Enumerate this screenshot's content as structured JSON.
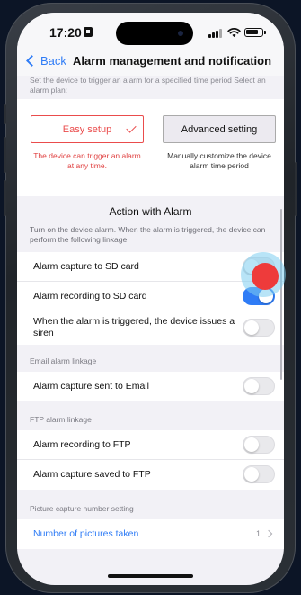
{
  "status": {
    "time": "17:20"
  },
  "nav": {
    "back_label": "Back",
    "title": "Alarm management and notification"
  },
  "intro": {
    "hint": "Set the device to trigger an alarm for a specified time period Select an alarm plan:"
  },
  "plans": {
    "easy": {
      "label": "Easy setup",
      "desc": "The device can trigger an alarm at any time.",
      "selected": true
    },
    "advanced": {
      "label": "Advanced setting",
      "desc": "Manually customize the device alarm time period"
    }
  },
  "action": {
    "title": "Action with Alarm",
    "desc": "Turn on the device alarm. When the alarm is triggered, the device can perform the following linkage:",
    "rows": [
      {
        "label": "Alarm capture to SD card",
        "on": false
      },
      {
        "label": "Alarm recording to SD card",
        "on": true
      },
      {
        "label": "When the alarm is triggered, the device issues a siren",
        "on": false
      }
    ]
  },
  "email": {
    "header": "Email alarm linkage",
    "rows": [
      {
        "label": "Alarm capture sent to Email",
        "on": false
      }
    ]
  },
  "ftp": {
    "header": "FTP alarm linkage",
    "rows": [
      {
        "label": "Alarm recording to FTP",
        "on": false
      },
      {
        "label": "Alarm capture saved to FTP",
        "on": false
      }
    ]
  },
  "capture": {
    "header": "Picture capture number setting",
    "row_label": "Number of pictures taken",
    "row_value": "1"
  },
  "colors": {
    "accent": "#2f7cf6",
    "alert": "#ea4c4c",
    "toggle_on": "#2f7cf6"
  }
}
